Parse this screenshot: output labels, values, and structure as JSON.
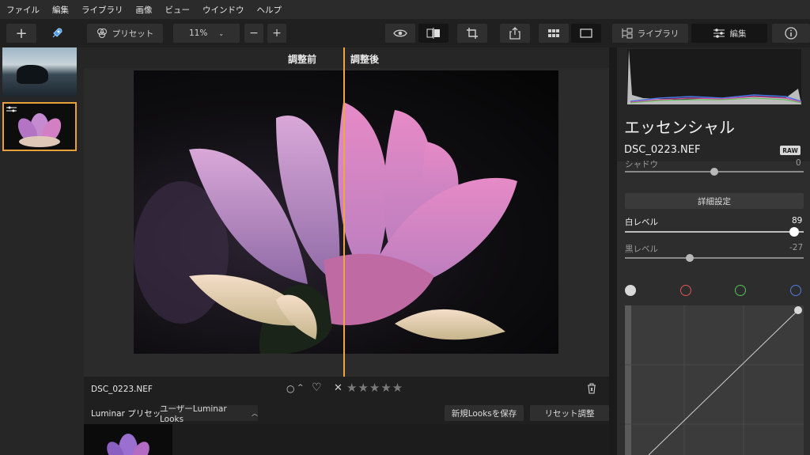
{
  "menu": [
    "ファイル",
    "編集",
    "ライブラリ",
    "画像",
    "ビュー",
    "ウインドウ",
    "ヘルプ"
  ],
  "toolbar": {
    "preset_label": "プリセット",
    "zoom_value": "11%",
    "zoom_minus": "−",
    "zoom_plus": "+",
    "add_label": "+",
    "library_label": "ライブラリ",
    "edit_label": "編集"
  },
  "compare": {
    "before_label": "調整前",
    "after_label": "調整後",
    "divider_color": "#f0a542"
  },
  "info": {
    "file_name": "DSC_0223.NEF",
    "rating_stars": "★★★★★",
    "reject_symbol": "✕",
    "circle_symbol": "○",
    "caret_symbol": "^",
    "heart_symbol": "♡"
  },
  "presets": {
    "label": "Luminar プリセット",
    "group_value": "ユーザーLuminar Looks",
    "save_label": "新規Looksを保存",
    "reset_label": "リセット調整"
  },
  "panel": {
    "title": "エッセンシャル",
    "file_name": "DSC_0223.NEF",
    "raw_badge": "RAW",
    "shadow_label": "シャドウ",
    "shadow_value": "0",
    "advanced_label": "詳細設定",
    "white_label": "白レベル",
    "white_value": "89",
    "white_level": 89,
    "black_label": "黒レベル",
    "black_value": "-27",
    "black_level": -27,
    "channel_colors": [
      "#d8d8d8",
      "#e05454",
      "#54c454",
      "#4f7be3"
    ]
  },
  "accent_color": "#e7a03a"
}
